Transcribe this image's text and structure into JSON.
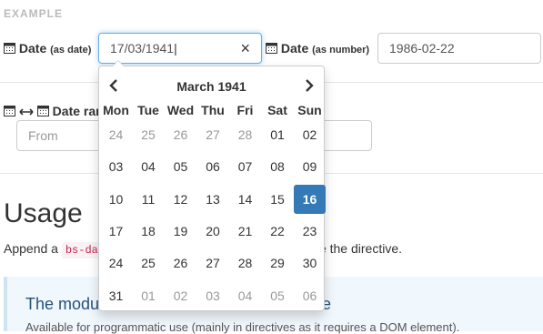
{
  "section_label": "EXAMPLE",
  "date_field": {
    "label": "Date",
    "hint": "(as date)",
    "value": "17/03/1941",
    "clear_glyph": "×"
  },
  "number_field": {
    "label": "Date",
    "hint": "(as number)",
    "value": "1986-02-22"
  },
  "range_field": {
    "label": "Date ran",
    "from_placeholder": "From"
  },
  "usage": {
    "heading": "Usage",
    "text_before": "Append a",
    "code": "bs-dat",
    "text_after": "ble the directive."
  },
  "callout": {
    "title_start": "The modul",
    "title_end": "ce",
    "body": "Available for programmatic use (mainly in directives as it requires a DOM element)."
  },
  "datepicker": {
    "month_title": "March 1941",
    "prev_glyph": "‹",
    "next_glyph": "›",
    "weekdays": [
      "Mon",
      "Tue",
      "Wed",
      "Thu",
      "Fri",
      "Sat",
      "Sun"
    ],
    "weeks": [
      [
        "24",
        "25",
        "26",
        "27",
        "28",
        "01",
        "02"
      ],
      [
        "03",
        "04",
        "05",
        "06",
        "07",
        "08",
        "09"
      ],
      [
        "10",
        "11",
        "12",
        "13",
        "14",
        "15",
        "16"
      ],
      [
        "17",
        "18",
        "19",
        "20",
        "21",
        "22",
        "23"
      ],
      [
        "24",
        "25",
        "26",
        "27",
        "28",
        "29",
        "30"
      ],
      [
        "31",
        "01",
        "02",
        "03",
        "04",
        "05",
        "06"
      ]
    ],
    "muted_days": {
      "0": [
        0,
        1,
        2,
        3,
        4
      ],
      "5": [
        1,
        2,
        3,
        4,
        5,
        6
      ]
    },
    "selected": {
      "week": 2,
      "day": 6
    },
    "selected_color": "#337ab7"
  }
}
